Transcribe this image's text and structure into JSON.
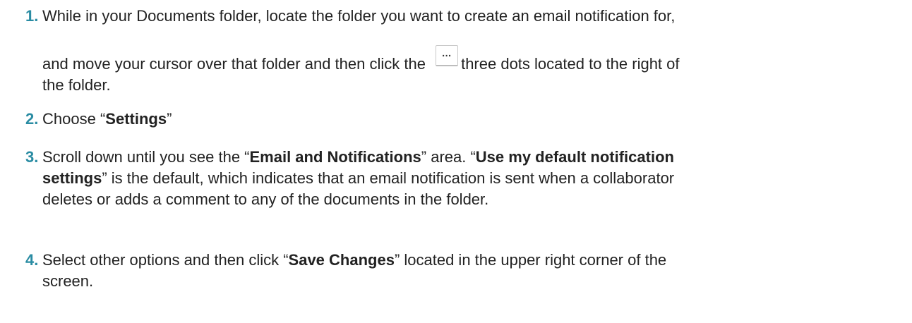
{
  "steps": [
    {
      "number": "1.",
      "line1": "While in your Documents folder, locate the folder you want to create an email notification for,",
      "line2_before": "and move your cursor over that folder and then click the ",
      "button_glyph": "…",
      "line2_after": "three dots located to the right of",
      "line3": "the folder."
    },
    {
      "number": "2.",
      "text_before": "Choose “",
      "bold": "Settings",
      "text_after": "”"
    },
    {
      "number": "3.",
      "l1_before": "Scroll down until you see the “",
      "l1_bold1": "Email and Notifications",
      "l1_mid": "” area. “",
      "l1_bold2": "Use my default notification",
      "l2_bold": "settings",
      "l2_after": "” is the default, which indicates that an email notification is sent when a collaborator",
      "l3": "deletes or adds a comment to any of the documents in the folder."
    },
    {
      "number": "4.",
      "l1_before": "Select other options and then click “",
      "l1_bold": "Save Changes",
      "l1_after": "” located in the upper right corner of the",
      "l2": "screen."
    }
  ]
}
